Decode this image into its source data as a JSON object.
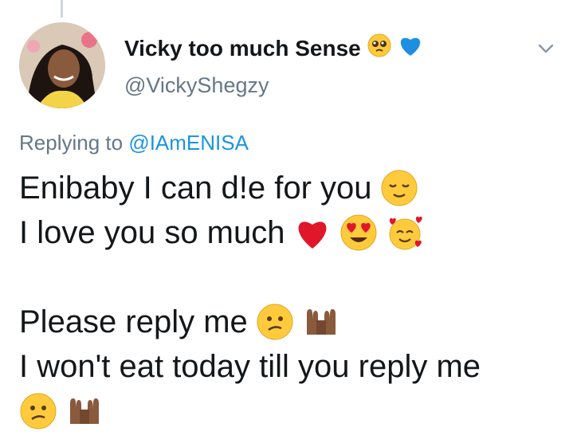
{
  "tweet": {
    "display_name": "Vicky too much Sense",
    "handle": "@VickyShegzy",
    "replying_prefix": "Replying to",
    "replying_to": "@IAmENISA",
    "lines": [
      "Enibaby I can d!e for you",
      "I love you so much",
      "",
      "Please reply me",
      "I won't eat today till you reply me"
    ],
    "name_emojis": [
      "pleading-face-emoji",
      "blue-heart-emoji"
    ],
    "line_emojis": {
      "line1": [
        "relieved-face-emoji"
      ],
      "line2": [
        "red-heart-emoji",
        "heart-eyes-emoji",
        "smiling-face-with-hearts-emoji"
      ],
      "line4": [
        "confused-face-emoji",
        "palms-up-together-emoji"
      ],
      "line6": [
        "confused-face-emoji",
        "palms-up-together-emoji"
      ]
    }
  },
  "colors": {
    "text": "#14171a",
    "secondary": "#657786",
    "link": "#1b95e0",
    "thread_line": "#cfd6dc",
    "blue_heart": "#1d8fe1",
    "red_heart": "#e0162b"
  }
}
